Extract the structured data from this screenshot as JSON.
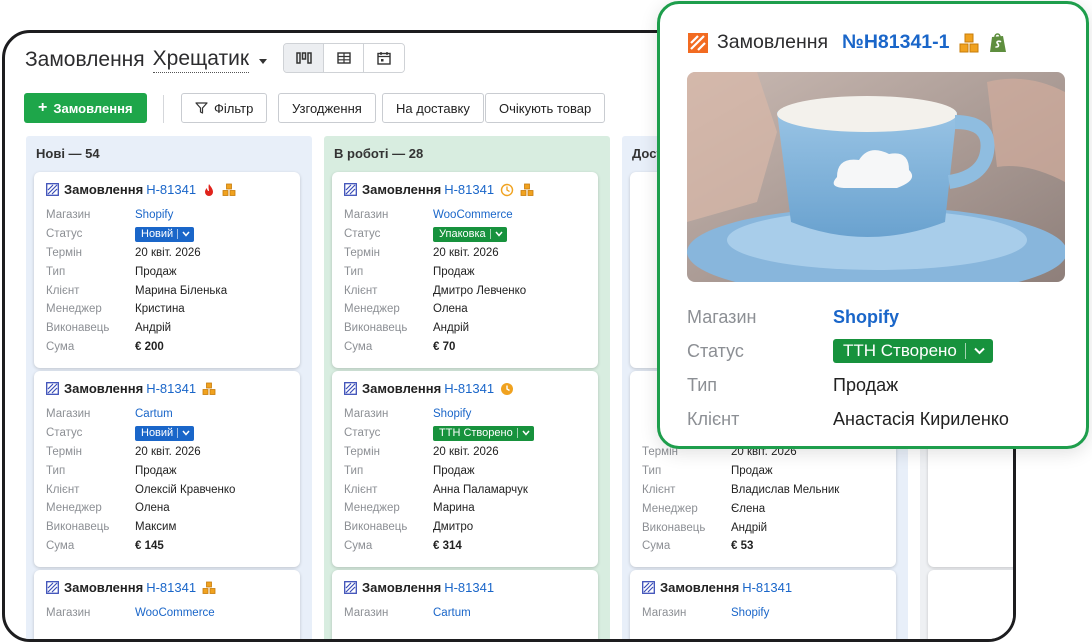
{
  "header": {
    "title": "Замовлення",
    "location": "Хрещатик"
  },
  "view_switch": {
    "options": [
      "kanban-icon",
      "table-icon",
      "calendar-icon"
    ],
    "active": "kanban-icon"
  },
  "toolbar": {
    "add_label": "Замовлення",
    "filter_label": "Фільтр",
    "tags": [
      "Узгодження",
      "На доставку",
      "Очікують товар"
    ]
  },
  "labels": {
    "order": "Замовлення",
    "store": "Магазин",
    "status": "Статус",
    "term": "Термін",
    "type": "Тип",
    "client": "Клієнт",
    "manager": "Менеджер",
    "executor": "Виконавець",
    "sum": "Сума"
  },
  "columns": [
    {
      "title": "Нові — 54",
      "bg": "#e8eff9",
      "cards": [
        {
          "number": "Н-81341",
          "icons": [
            "fire-icon",
            "boxes-icon"
          ],
          "store": "Shopify",
          "status": "Новий",
          "status_color": "blue",
          "term": "20 квіт. 2026",
          "type": "Продаж",
          "client": "Марина Біленька",
          "manager": "Кристина",
          "executor": "Андрій",
          "sum": "€ 200"
        },
        {
          "number": "Н-81341",
          "icons": [
            "boxes-icon"
          ],
          "store": "Cartum",
          "status": "Новий",
          "status_color": "blue",
          "term": "20 квіт. 2026",
          "type": "Продаж",
          "client": "Олексій Кравченко",
          "manager": "Олена",
          "executor": "Максим",
          "sum": "€ 145"
        },
        {
          "number": "Н-81341",
          "icons": [
            "boxes-icon"
          ],
          "store": "WooCommerce"
        }
      ]
    },
    {
      "title": "В роботі — 28",
      "bg": "#d8ede0",
      "cards": [
        {
          "number": "Н-81341",
          "icons": [
            "clock-icon",
            "boxes-icon"
          ],
          "store": "WooCommerce",
          "status": "Упаковка",
          "status_color": "green",
          "term": "20 квіт. 2026",
          "type": "Продаж",
          "client": "Дмитро Левченко",
          "manager": "Олена",
          "executor": "Андрій",
          "sum": "€ 70"
        },
        {
          "number": "Н-81341",
          "icons": [
            "clock-filled-icon"
          ],
          "store": "Shopify",
          "status": "ТТН Створено",
          "status_color": "green",
          "term": "20 квіт. 2026",
          "type": "Продаж",
          "client": "Анна Паламарчук",
          "manager": "Марина",
          "executor": "Дмитро",
          "sum": "€ 314"
        },
        {
          "number": "Н-81341",
          "icons": [],
          "store": "Cartum"
        }
      ]
    },
    {
      "title": "Дост",
      "bg": "#e8eff9",
      "cards": [
        {
          "number": "",
          "icons": []
        },
        {
          "number": "",
          "icons": [],
          "term": "20 квіт. 2026",
          "type": "Продаж",
          "client": "Владислав Мельник",
          "manager": "Єлена",
          "executor": "Андрій",
          "sum": "€ 53"
        },
        {
          "number": "Н-81341",
          "icons": [],
          "store": "Shopify"
        }
      ]
    }
  ],
  "popup": {
    "title": "Замовлення",
    "number": "№Н81341-1",
    "icons": [
      "boxes-icon",
      "shopify-icon"
    ],
    "rows": [
      {
        "label": "Магазин",
        "value": "Shopify"
      },
      {
        "label": "Статус",
        "value": "ТТН Створено"
      },
      {
        "label": "Тип",
        "value": "Продаж"
      },
      {
        "label": "Клієнт",
        "value": "Анастасія Кириленко"
      }
    ]
  },
  "colors": {
    "accent_green": "#1ea64a",
    "link_blue": "#1a66c9",
    "status_green": "#17923d",
    "popup_border": "#1e9e4c",
    "order_icon": "#f26b21"
  }
}
